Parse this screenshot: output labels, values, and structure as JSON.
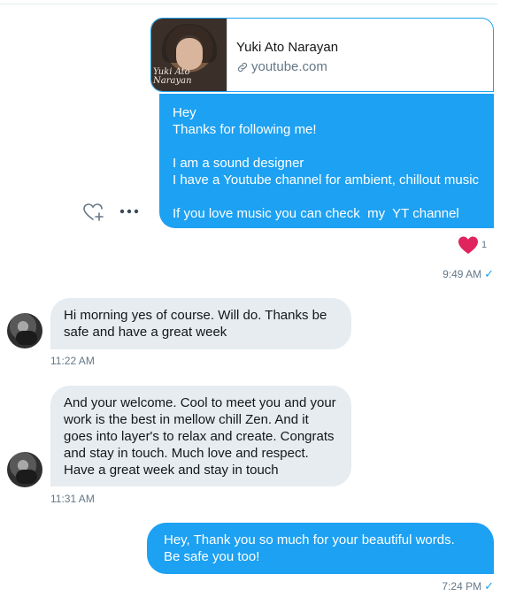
{
  "link_card": {
    "title": "Yuki Ato Narayan",
    "domain": "youtube.com",
    "thumb_watermark": "Yuki Ato Narayan"
  },
  "messages": [
    {
      "direction": "outgoing",
      "text": "Hey\nThanks for following me!\n\nI am a sound designer\nI have a Youtube channel for ambient, chillout music\n\nIf you love music you can check  my  YT channel",
      "reaction_count": "1",
      "time": "9:49 AM"
    },
    {
      "direction": "incoming",
      "text": "Hi morning yes of course. Will do. Thanks be safe and have a great week",
      "time": "11:22 AM"
    },
    {
      "direction": "incoming",
      "text": "And your welcome. Cool to meet you and your work is the best in mellow chill Zen. And it goes into layer's to relax and create. Congrats and stay in touch. Much love and respect. Have a great week and stay in touch",
      "time": "11:31 AM"
    },
    {
      "direction": "outgoing",
      "text": "Hey, Thank you so much for your beautiful words.  Be safe you too!",
      "time": "7:24 PM"
    }
  ],
  "icons": {
    "read_receipt": "check-icon",
    "reaction": "heart-icon",
    "add_reaction": "heart-plus-icon",
    "more": "more-icon",
    "link": "link-icon"
  },
  "colors": {
    "accent": "#1da1f2",
    "incoming_bubble": "#e6ecf0",
    "heart": "#e0245e",
    "meta_text": "#657786"
  }
}
